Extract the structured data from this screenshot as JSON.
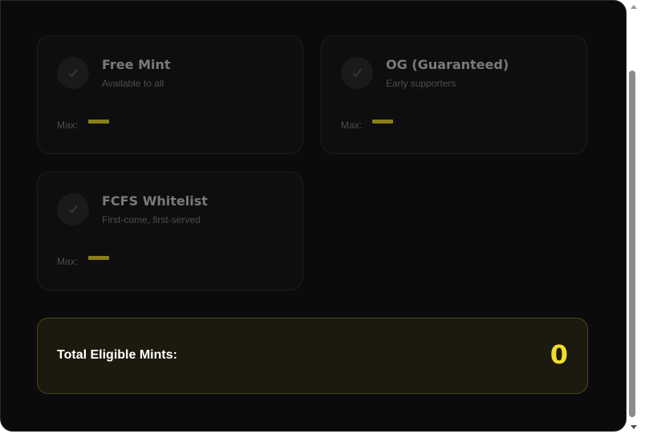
{
  "tiers": [
    {
      "title": "Free Mint",
      "subtitle": "Available to all",
      "max_label": "Max:"
    },
    {
      "title": "OG (Guaranteed)",
      "subtitle": "Early supporters",
      "max_label": "Max:"
    },
    {
      "title": "FCFS Whitelist",
      "subtitle": "First-come, first-served",
      "max_label": "Max:"
    }
  ],
  "total": {
    "label": "Total Eligible Mints:",
    "value": "0"
  },
  "colors": {
    "accent": "#f2dd2c",
    "placeholder_bar": "#8a7e18",
    "background": "#0b0b0b"
  },
  "icons": {
    "tier_check": "check-icon",
    "scroll_up": "chevron-up-icon",
    "scroll_down": "chevron-down-icon"
  }
}
